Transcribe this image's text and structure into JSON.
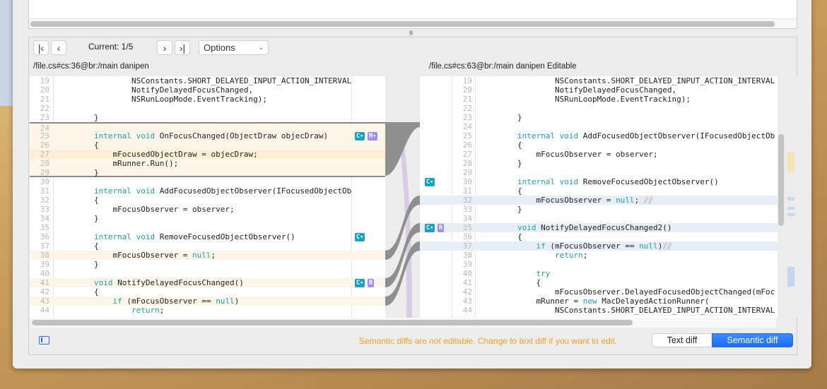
{
  "navigation": {
    "first_icon": "first-diff-icon",
    "prev_icon": "previous-diff-icon",
    "next_icon": "next-diff-icon",
    "last_icon": "last-diff-icon",
    "current_label": "Current: 1/5",
    "options_label": "Options"
  },
  "left": {
    "path": "/file.cs#cs:36@br:/main danipen",
    "lines": [
      {
        "n": "19",
        "code": [
          [
            "",
            "                NSConstants.SHORT_DELAYED_INPUT_ACTION_INTERVAL"
          ]
        ]
      },
      {
        "n": "20",
        "code": [
          [
            "",
            "                NotifyDelayedFocusChanged,"
          ]
        ]
      },
      {
        "n": "21",
        "code": [
          [
            "",
            "                NSRunLoopMode.EventTracking);"
          ]
        ]
      },
      {
        "n": "22",
        "code": []
      },
      {
        "n": "23",
        "code": [
          [
            "",
            "        }"
          ]
        ]
      },
      {
        "n": "24",
        "code": [],
        "bg": "change"
      },
      {
        "n": "25",
        "code": [
          [
            "",
            "        "
          ],
          [
            "kw",
            "internal void"
          ],
          [
            "",
            " OnFocusChanged(ObjectDraw objecDraw)"
          ]
        ],
        "bg": "change"
      },
      {
        "n": "26",
        "code": [
          [
            "",
            "        {"
          ]
        ],
        "bg": "change"
      },
      {
        "n": "27",
        "code": [
          [
            "",
            "            mFocusedObjectDraw = objecDraw;"
          ]
        ],
        "bg": "change-strong"
      },
      {
        "n": "28",
        "code": [
          [
            "",
            "            mRunner.Run();"
          ]
        ],
        "bg": "change"
      },
      {
        "n": "29",
        "code": [
          [
            "",
            "        }"
          ]
        ],
        "bg": "change"
      },
      {
        "n": "30",
        "code": []
      },
      {
        "n": "31",
        "code": [
          [
            "",
            "        "
          ],
          [
            "kw",
            "internal void"
          ],
          [
            "",
            " AddFocusedObjectObserver(IFocusedObjectOb"
          ]
        ]
      },
      {
        "n": "32",
        "code": [
          [
            "",
            "        {"
          ]
        ]
      },
      {
        "n": "33",
        "code": [
          [
            "",
            "            mFocusObserver = observer;"
          ]
        ]
      },
      {
        "n": "34",
        "code": [
          [
            "",
            "        }"
          ]
        ]
      },
      {
        "n": "35",
        "code": []
      },
      {
        "n": "36",
        "code": [
          [
            "",
            "        "
          ],
          [
            "kw",
            "internal void"
          ],
          [
            "",
            " RemoveFocusedObjectObserver()"
          ]
        ]
      },
      {
        "n": "37",
        "code": [
          [
            "",
            "        {"
          ]
        ]
      },
      {
        "n": "38",
        "code": [
          [
            "",
            "            mFocusObserver = "
          ],
          [
            "kw",
            "null"
          ],
          [
            "",
            ";"
          ]
        ],
        "bg": "change"
      },
      {
        "n": "39",
        "code": [
          [
            "",
            "        }"
          ]
        ]
      },
      {
        "n": "40",
        "code": []
      },
      {
        "n": "41",
        "code": [
          [
            "",
            "        "
          ],
          [
            "kw",
            "void"
          ],
          [
            "",
            " NotifyDelayedFocusChanged()"
          ]
        ],
        "bg": "change"
      },
      {
        "n": "42",
        "code": [
          [
            "",
            "        {"
          ]
        ]
      },
      {
        "n": "43",
        "code": [
          [
            "",
            "            "
          ],
          [
            "kw",
            "if"
          ],
          [
            "",
            " (mFocusObserver == "
          ],
          [
            "kw",
            "null"
          ],
          [
            "",
            ")"
          ]
        ],
        "bg": "change"
      },
      {
        "n": "44",
        "code": [
          [
            "",
            "                "
          ],
          [
            "kw",
            "return"
          ],
          [
            "",
            ";"
          ]
        ]
      }
    ],
    "badges": [
      {
        "line": "25",
        "items": [
          {
            "label": "C▾",
            "type": "changed"
          },
          {
            "label": "M▾",
            "type": "moved"
          }
        ]
      },
      {
        "line": "36",
        "items": [
          {
            "label": "C▾",
            "type": "changed"
          }
        ]
      },
      {
        "line": "41",
        "items": [
          {
            "label": "C▾",
            "type": "changed"
          },
          {
            "label": "R",
            "type": "renamed"
          }
        ]
      }
    ]
  },
  "right": {
    "path": "/file.cs#cs:63@br:/main danipen Editable",
    "lines": [
      {
        "n": "19",
        "code": [
          [
            "",
            "                NSConstants.SHORT_DELAYED_INPUT_ACTION_INTERVAL"
          ]
        ]
      },
      {
        "n": "20",
        "code": [
          [
            "",
            "                NotifyDelayedFocusChanged,"
          ]
        ]
      },
      {
        "n": "21",
        "code": [
          [
            "",
            "                NSRunLoopMode.EventTracking);"
          ]
        ]
      },
      {
        "n": "22",
        "code": []
      },
      {
        "n": "23",
        "code": [
          [
            "",
            "        }"
          ]
        ]
      },
      {
        "n": "24",
        "code": []
      },
      {
        "n": "25",
        "code": [
          [
            "",
            "        "
          ],
          [
            "kw",
            "internal void"
          ],
          [
            "",
            " AddFocusedObjectObserver(IFocusedObjectOb"
          ]
        ]
      },
      {
        "n": "26",
        "code": [
          [
            "",
            "        {"
          ]
        ]
      },
      {
        "n": "27",
        "code": [
          [
            "",
            "            mFocusObserver = observer;"
          ]
        ]
      },
      {
        "n": "28",
        "code": [
          [
            "",
            "        }"
          ]
        ]
      },
      {
        "n": "29",
        "code": []
      },
      {
        "n": "30",
        "code": [
          [
            "",
            "        "
          ],
          [
            "kw",
            "internal void"
          ],
          [
            "",
            " RemoveFocusedObjectObserver()"
          ]
        ]
      },
      {
        "n": "31",
        "code": [
          [
            "",
            "        {"
          ]
        ]
      },
      {
        "n": "32",
        "code": [
          [
            "",
            "            mFocusObserver = "
          ],
          [
            "kw",
            "null"
          ],
          [
            "",
            ";"
          ],
          [
            "cm",
            " //"
          ]
        ],
        "bg": "added"
      },
      {
        "n": "33",
        "code": [
          [
            "",
            "        }"
          ]
        ]
      },
      {
        "n": "34",
        "code": []
      },
      {
        "n": "35",
        "code": [
          [
            "",
            "        "
          ],
          [
            "kw",
            "void"
          ],
          [
            "",
            " NotifyDelayedFocusChanged2()"
          ]
        ],
        "bg": "added"
      },
      {
        "n": "36",
        "code": [
          [
            "",
            "        {"
          ]
        ]
      },
      {
        "n": "37",
        "code": [
          [
            "",
            "            "
          ],
          [
            "kw",
            "if"
          ],
          [
            "",
            " (mFocusObserver == "
          ],
          [
            "kw",
            "null"
          ],
          [
            "",
            ")"
          ],
          [
            "cm",
            "//"
          ]
        ],
        "bg": "added"
      },
      {
        "n": "38",
        "code": [
          [
            "",
            "                "
          ],
          [
            "kw",
            "return"
          ],
          [
            "",
            ";"
          ]
        ]
      },
      {
        "n": "39",
        "code": []
      },
      {
        "n": "40",
        "code": [
          [
            "",
            "            "
          ],
          [
            "kw",
            "try"
          ]
        ]
      },
      {
        "n": "41",
        "code": [
          [
            "",
            "            {"
          ]
        ]
      },
      {
        "n": "42",
        "code": [
          [
            "",
            "                mFocusObserver.DelayedFocusedObjectChanged(mFoc"
          ]
        ]
      },
      {
        "n": "43",
        "code": [
          [
            "",
            "            mRunner = "
          ],
          [
            "kw",
            "new"
          ],
          [
            "",
            " MacDelayedActionRunner("
          ]
        ]
      },
      {
        "n": "44",
        "code": [
          [
            "",
            "                NSConstants.SHORT_DELAYED_INPUT_ACTION_INTERVAL"
          ]
        ]
      }
    ],
    "badges": [
      {
        "line": "30",
        "items": [
          {
            "label": "C▾",
            "type": "changed"
          }
        ]
      },
      {
        "line": "35",
        "items": [
          {
            "label": "C▾",
            "type": "changed"
          },
          {
            "label": "R",
            "type": "renamed"
          }
        ]
      }
    ]
  },
  "footer": {
    "status_message": "Semantic diffs are not editable. Change to text diff if you want to edit.",
    "text_diff_label": "Text diff",
    "semantic_diff_label": "Semantic diff",
    "selected_mode": "Semantic diff"
  },
  "colors": {
    "keyword": "#1a9fb0",
    "change_bg": "#fdf6e8",
    "change_strong_bg": "#fcefd6",
    "added_bg": "#e8eef6",
    "badge_changed": "#1aa1c4",
    "badge_moved": "#9b8ff0",
    "warning_text": "#f0a21e",
    "accent": "#1e6ff5"
  }
}
